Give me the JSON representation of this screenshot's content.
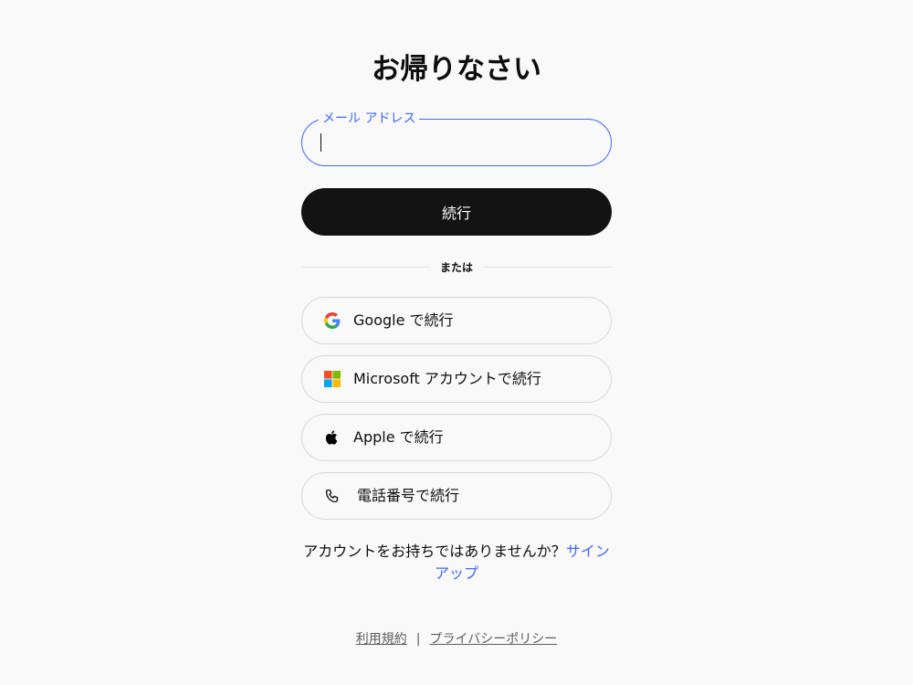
{
  "page": {
    "title": "お帰りなさい"
  },
  "email": {
    "label": "メール アドレス",
    "value": "",
    "placeholder": ""
  },
  "actions": {
    "continue_label": "続行",
    "divider_label": "または"
  },
  "social": [
    {
      "label": "Google で続行",
      "icon": "google-icon"
    },
    {
      "label": "Microsoft アカウントで続行",
      "icon": "microsoft-icon"
    },
    {
      "label": "Apple で続行",
      "icon": "apple-icon"
    },
    {
      "label": "電話番号で続行",
      "icon": "phone-icon"
    }
  ],
  "signup": {
    "prompt": "アカウントをお持ちではありませんか？",
    "link_label": "サインアップ"
  },
  "footer": {
    "terms_label": "利用規約",
    "separator": "|",
    "privacy_label": "プライバシーポリシー"
  },
  "colors": {
    "accent": "#3e68ff",
    "primary_button": "#131313",
    "background": "#f9f9f9"
  }
}
